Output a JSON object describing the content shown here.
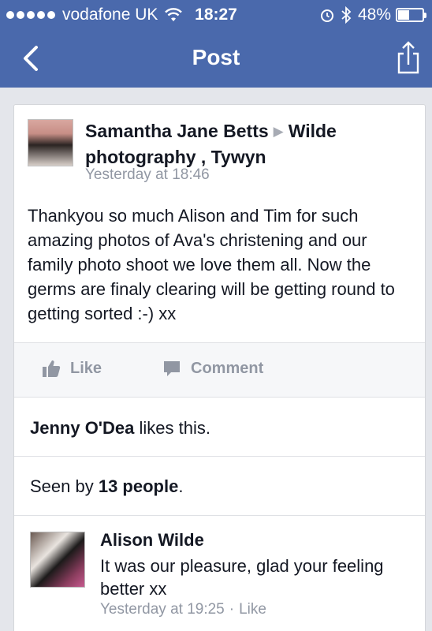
{
  "status_bar": {
    "carrier": "vodafone UK",
    "time": "18:27",
    "battery_percent": "48%",
    "battery_level": 0.48,
    "icons": [
      "signal-dots-icon",
      "wifi-icon",
      "alarm-icon",
      "bluetooth-icon",
      "battery-icon"
    ]
  },
  "nav": {
    "title": "Post",
    "back_icon": "chevron-left-icon",
    "share_icon": "share-icon"
  },
  "post": {
    "author": "Samantha Jane Betts",
    "target": "Wilde photography , Tywyn",
    "timestamp": "Yesterday at 18:46",
    "body": "Thankyou so much Alison and Tim for such amazing photos of Ava's christening and our family photo shoot we love them all. Now the germs are finaly clearing will be getting round to getting sorted :-) xx",
    "actions": {
      "like": "Like",
      "comment": "Comment"
    },
    "likes": {
      "name": "Jenny O'Dea",
      "suffix": " likes this."
    },
    "seen": {
      "prefix": "Seen by ",
      "count": "13 people",
      "suffix": "."
    }
  },
  "comment": {
    "author": "Alison Wilde",
    "text": "It was our pleasure, glad your feeling better xx",
    "timestamp": "Yesterday at 19:25",
    "separator": "·",
    "like": "Like"
  },
  "colors": {
    "header": "#4a69ac",
    "background": "#e4e6eb",
    "muted": "#9197a3"
  }
}
